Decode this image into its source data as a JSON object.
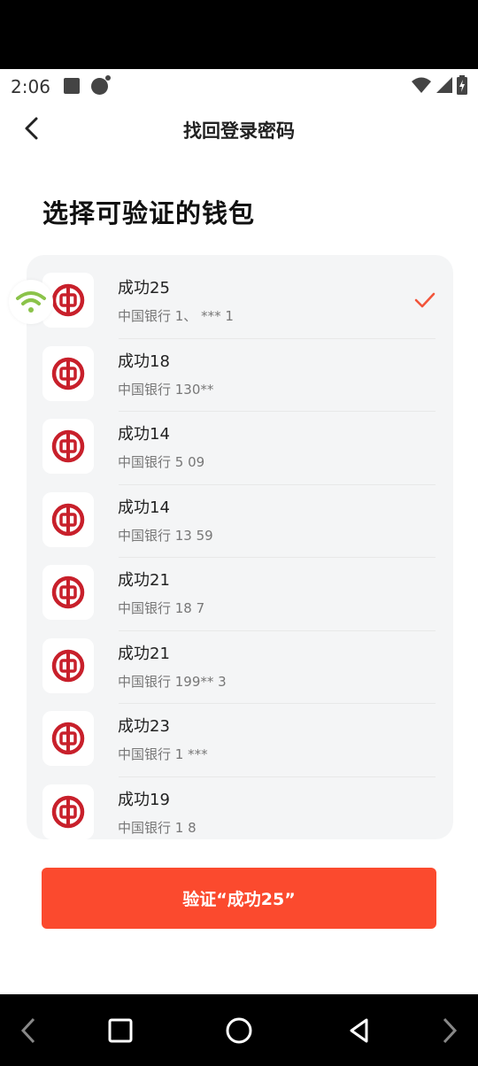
{
  "status_bar": {
    "time": "2:06"
  },
  "header": {
    "title": "找回登录密码"
  },
  "section": {
    "title": "选择可验证的钱包"
  },
  "wallets": [
    {
      "name": "成功25",
      "account": "中国银行 1、 ***  1",
      "selected": true
    },
    {
      "name": "成功18",
      "account": "中国银行 130**",
      "selected": false
    },
    {
      "name": "成功14",
      "account": "中国银行 5 09",
      "selected": false
    },
    {
      "name": "成功14",
      "account": "中国银行 13 59",
      "selected": false
    },
    {
      "name": "成功21",
      "account": "中国银行 18 7",
      "selected": false
    },
    {
      "name": "成功21",
      "account": "中国银行 199** 3",
      "selected": false
    },
    {
      "name": "成功23",
      "account": "中国银行 1 ***",
      "selected": false
    },
    {
      "name": "成功19",
      "account": "中国银行 1 8",
      "selected": false
    }
  ],
  "verify_button": {
    "label": "验证“成功25”"
  },
  "colors": {
    "accent": "#fb4a2e",
    "bank_red": "#c8202b",
    "check": "#f2553b",
    "wifi_green": "#8bc34a"
  },
  "icons": {
    "back": "chevron-left-icon",
    "bank": "bank-of-china-logo",
    "check": "checkmark-icon",
    "wifi": "wifi-icon"
  }
}
